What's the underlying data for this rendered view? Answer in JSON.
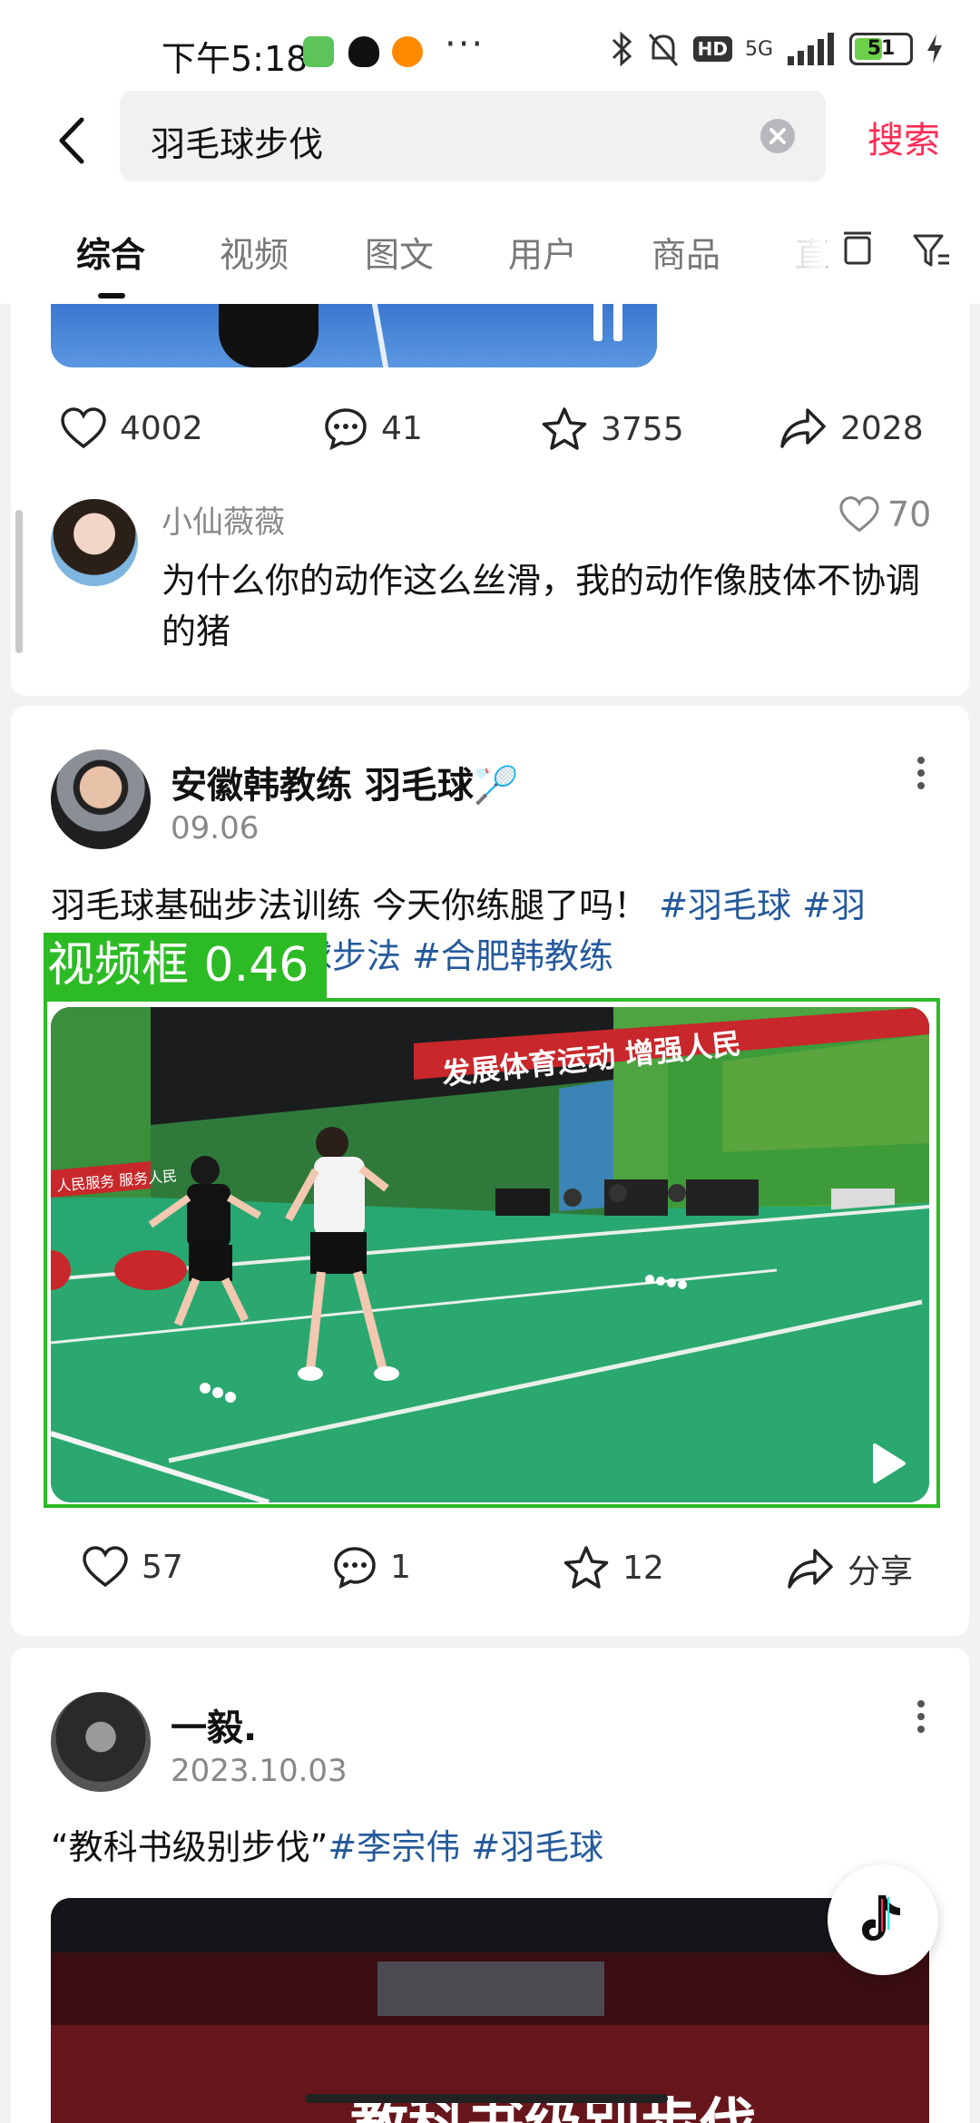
{
  "status_bar": {
    "time": "下午5:18",
    "network": "5G",
    "hd_badge": "HD",
    "battery": 51,
    "battery_label": "51"
  },
  "search": {
    "query": "羽毛球步伐",
    "submit_label": "搜索"
  },
  "tabs": [
    {
      "label": "综合",
      "active": true
    },
    {
      "label": "视频"
    },
    {
      "label": "图文"
    },
    {
      "label": "用户"
    },
    {
      "label": "商品"
    },
    {
      "label": "直"
    }
  ],
  "post1": {
    "actions": {
      "likes": "4002",
      "comments": "41",
      "favorites": "3755",
      "shares": "2028"
    },
    "top_comment": {
      "author": "小仙薇薇",
      "likes": "70",
      "text": "为什么你的动作这么丝滑，我的动作像肢体不协调的猪"
    }
  },
  "post2": {
    "author": "安徽韩教练 羽毛球🏸",
    "date": "09.06",
    "text": "羽毛球基础步法训练 今天你练腿了吗！",
    "hashtags_line1": "#羽毛球 #羽",
    "hashtags_line2": "毛球训练 #羽毛球步法 #合肥韩教练",
    "video": {
      "banner_text": "发展体育运动 增强人民",
      "left_banner_text": "人民服务 服务人民"
    },
    "actions": {
      "likes": "57",
      "comments": "1",
      "favorites": "12",
      "share_label": "分享"
    }
  },
  "detection": {
    "label": "视频框 0.46",
    "color": "#2dbb25"
  },
  "post3": {
    "author": "一毅.",
    "date": "2023.10.03",
    "text": "“教科书级别步伐”",
    "hashtags": "#李宗伟 #羽毛球",
    "video_caption": "教科书级别步伐"
  },
  "colors": {
    "accent": "#fe2c55",
    "hashtag": "#255a9c"
  }
}
